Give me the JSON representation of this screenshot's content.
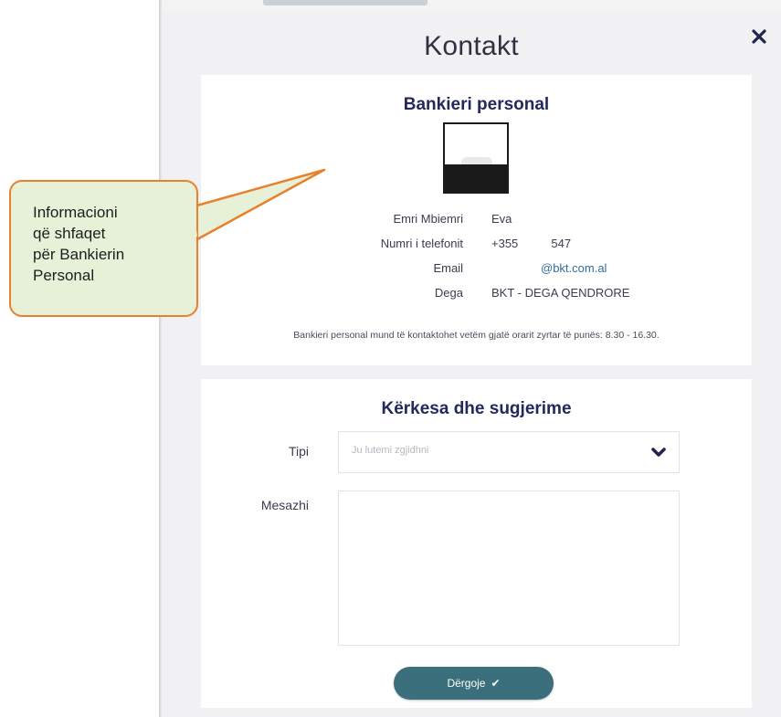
{
  "modal": {
    "title": "Kontakt",
    "close_icon": "close-icon"
  },
  "banker": {
    "heading": "Bankieri personal",
    "rows": [
      {
        "label": "Emri Mbiemri",
        "value": "Eva"
      },
      {
        "label": "Numri i telefonit",
        "value": "+355          547"
      },
      {
        "label": "Email",
        "value": "@bkt.com.al"
      },
      {
        "label": "Dega",
        "value": "BKT - DEGA QENDRORE"
      }
    ],
    "note": "Bankieri personal mund të kontaktohet vetëm gjatë orarit zyrtar të punës: 8.30 - 16.30."
  },
  "requests": {
    "heading": "Kërkesa dhe sugjerime",
    "type_label": "Tipi",
    "type_placeholder": "Ju lutemi zgjidhni",
    "message_label": "Mesazhi",
    "submit_label": "Dërgoje",
    "submit_icon": "check-icon"
  },
  "callout": {
    "text": "Informacioni\nqë shfaqet\npër Bankierin\nPersonal"
  },
  "colors": {
    "accent_button": "#3b6f7c",
    "heading_navy": "#24285a",
    "callout_fill": "#e6f1d8",
    "callout_border": "#e8802c"
  }
}
